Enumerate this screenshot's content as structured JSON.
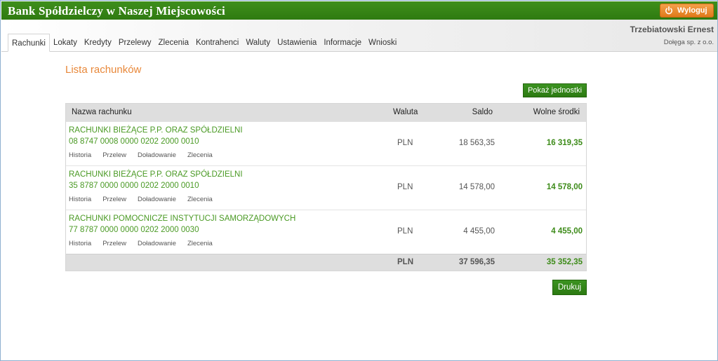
{
  "header": {
    "bank_name": "Bank Spółdzielczy w Naszej Miejscowości",
    "logout_label": "Wyloguj",
    "user_name": "Trzebiatowski Ernest",
    "company": "Dołęga sp. z o.o."
  },
  "nav": {
    "tabs": [
      "Rachunki",
      "Lokaty",
      "Kredyty",
      "Przelewy",
      "Zlecenia",
      "Kontrahenci",
      "Waluty",
      "Ustawienia",
      "Informacje",
      "Wnioski"
    ],
    "active": "Rachunki"
  },
  "main": {
    "title": "Lista rachunków",
    "units_button": "Pokaż jednostki",
    "print_button": "Drukuj"
  },
  "table": {
    "headers": {
      "name": "Nazwa rachunku",
      "currency": "Waluta",
      "balance": "Saldo",
      "available": "Wolne środki"
    },
    "rows": [
      {
        "name": "RACHUNKI BIEŻĄCE P.P. ORAZ SPÓŁDZIELNI",
        "number": "08 8747 0008 0000 0202 2000 0010",
        "currency": "PLN",
        "balance": "18 563,35",
        "available": "16 319,35"
      },
      {
        "name": "RACHUNKI BIEŻĄCE P.P. ORAZ SPÓŁDZIELNI",
        "number": "35 8787 0000 0000 0202 2000 0010",
        "currency": "PLN",
        "balance": "14 578,00",
        "available": "14 578,00"
      },
      {
        "name": "RACHUNKI POMOCNICZE INSTYTUCJI SAMORZĄDOWYCH",
        "number": "77 8787 0000 0000 0202 2000 0030",
        "currency": "PLN",
        "balance": "4 455,00",
        "available": "4 455,00"
      }
    ],
    "actions": [
      "Historia",
      "Przelew",
      "Doładowanie",
      "Zlecenia"
    ],
    "total": {
      "currency": "PLN",
      "balance": "37 596,35",
      "available": "35 352,35"
    }
  },
  "colors": {
    "brand_green": "#2e7a10",
    "accent_orange": "#e8883a",
    "logout_orange": "#e07a1a"
  },
  "icons": {
    "logout": "power-icon"
  }
}
